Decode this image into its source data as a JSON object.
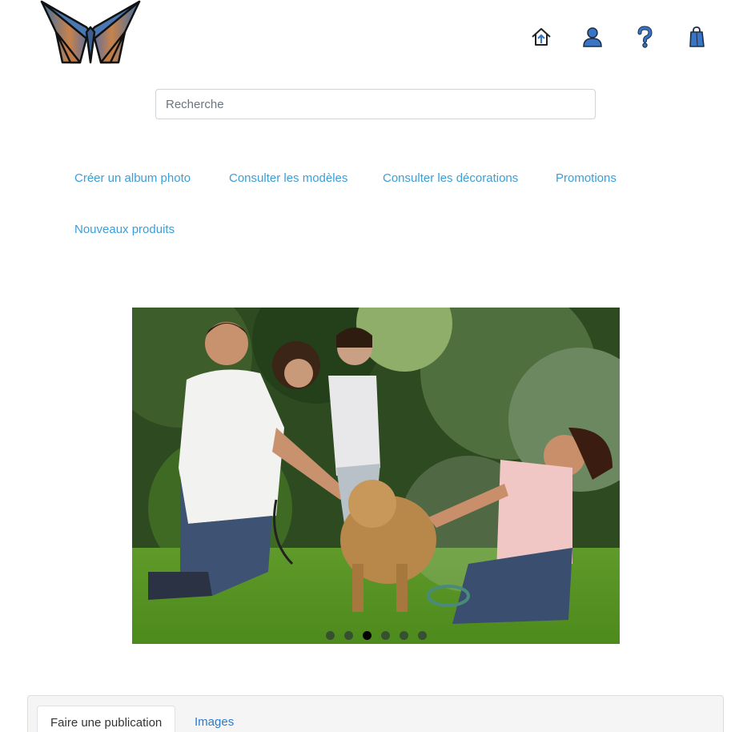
{
  "header": {
    "logo_icon": "butterfly-logo-icon",
    "icons": [
      {
        "name": "home-icon",
        "color": "#222222"
      },
      {
        "name": "user-icon",
        "color": "#3a74c4"
      },
      {
        "name": "help-icon",
        "color": "#3a74c4"
      },
      {
        "name": "shopping-bag-icon",
        "color": "#3a74c4"
      }
    ]
  },
  "search": {
    "placeholder": "Recherche",
    "value": ""
  },
  "nav": {
    "items": [
      {
        "label": "Créer un album photo"
      },
      {
        "label": "Consulter les modèles"
      },
      {
        "label": "Consulter les décorations"
      },
      {
        "label": "Promotions"
      },
      {
        "label": "Nouveaux produits"
      }
    ],
    "link_color": "#3a9fd8"
  },
  "carousel": {
    "slide_count": 6,
    "active_index": 2
  },
  "tabs": {
    "items": [
      {
        "label": "Faire une publication",
        "active": true
      },
      {
        "label": "Images",
        "active": false
      }
    ]
  }
}
